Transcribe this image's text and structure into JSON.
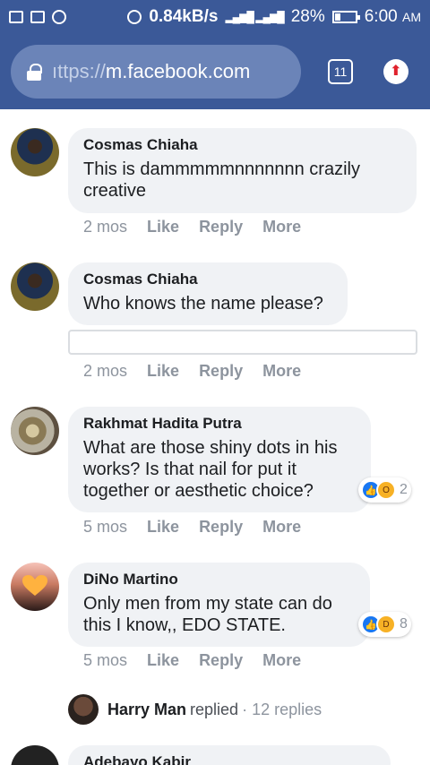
{
  "status_bar": {
    "speed": "0.84kB/s",
    "battery_percent": "28%",
    "battery_level": 0.28,
    "time": "6:00",
    "ampm": "AM",
    "icons": [
      "image-icon",
      "screenshot-icon",
      "whatsapp-icon",
      "alarm-icon",
      "signal-icon",
      "battery-icon"
    ]
  },
  "browser": {
    "url_prefix": "ıttps://",
    "url_host": "m.facebook.com",
    "tab_count": "11"
  },
  "comments": [
    {
      "author": "Cosmas Chiaha",
      "text": "This is dammmmmnnnnnnn crazily creative",
      "time": "2 mos",
      "like_label": "Like",
      "reply_label": "Reply",
      "more_label": "More"
    },
    {
      "author": "Cosmas Chiaha",
      "text": "Who knows the name please?",
      "time": "2 mos",
      "like_label": "Like",
      "reply_label": "Reply",
      "more_label": "More"
    },
    {
      "author": "Rakhmat Hadita Putra",
      "text": "What are those shiny dots in his works? Is that nail for put it together or aesthetic choice?",
      "time": "5 mos",
      "like_label": "Like",
      "reply_label": "Reply",
      "more_label": "More",
      "reaction_count": "2",
      "reactions": [
        "like-reaction-icon",
        "wow-reaction-icon"
      ]
    },
    {
      "author": "DiNo Martino",
      "text": "Only men from my state can do this I know,, EDO STATE.",
      "time": "5 mos",
      "like_label": "Like",
      "reply_label": "Reply",
      "more_label": "More",
      "reaction_count": "8",
      "reactions": [
        "like-reaction-icon",
        "haha-reaction-icon"
      ]
    }
  ],
  "reply_summary": {
    "name": "Harry Man",
    "verb": "replied",
    "count": "· 12 replies"
  },
  "next_comment": {
    "author": "Adebayo Kabir"
  },
  "colors": {
    "facebook_blue": "#3b5998",
    "bubble_gray": "#f0f2f5",
    "meta_gray": "#8d949e",
    "like_blue": "#1877f2"
  }
}
